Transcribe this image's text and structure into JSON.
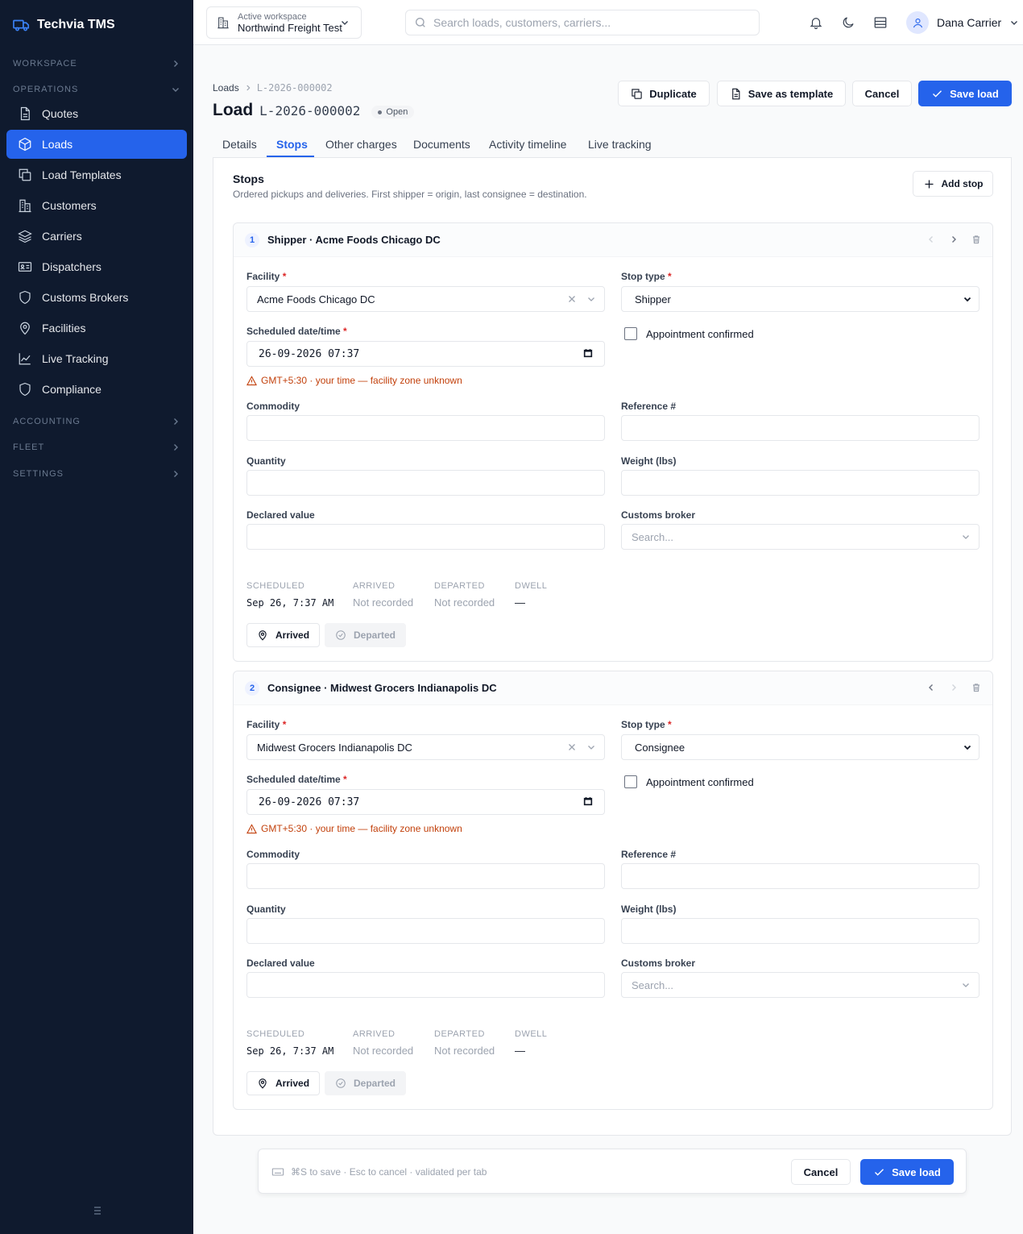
{
  "app": {
    "name": "Techvia TMS"
  },
  "sidebar": {
    "sections": {
      "workspace": "WORKSPACE",
      "operations": "OPERATIONS",
      "accounting": "ACCOUNTING",
      "fleet": "FLEET",
      "settings": "SETTINGS"
    },
    "items": [
      {
        "label": "Quotes",
        "icon": "document-icon"
      },
      {
        "label": "Loads",
        "icon": "box-icon",
        "active": true
      },
      {
        "label": "Load Templates",
        "icon": "copy-icon"
      },
      {
        "label": "Customers",
        "icon": "building-icon"
      },
      {
        "label": "Carriers",
        "icon": "layers-icon"
      },
      {
        "label": "Dispatchers",
        "icon": "id-card-icon"
      },
      {
        "label": "Customs Brokers",
        "icon": "shield-icon"
      },
      {
        "label": "Facilities",
        "icon": "map-pin-icon"
      },
      {
        "label": "Live Tracking",
        "icon": "chart-line-icon"
      },
      {
        "label": "Compliance",
        "icon": "shield-icon"
      }
    ]
  },
  "topbar": {
    "workspace_label": "Active workspace",
    "workspace_name": "Northwind Freight Test",
    "search_placeholder": "Search loads, customers, carriers...",
    "user_name": "Dana Carrier"
  },
  "header": {
    "breadcrumb_root": "Loads",
    "breadcrumb_current": "L-2026-000002",
    "title": "Load",
    "load_id": "L-2026-000002",
    "status": "Open",
    "buttons": {
      "duplicate": "Duplicate",
      "save_template": "Save as template",
      "cancel": "Cancel",
      "save": "Save load"
    }
  },
  "tabs": [
    "Details",
    "Stops",
    "Other charges",
    "Documents",
    "Activity timeline",
    "Live tracking"
  ],
  "active_tab": "Stops",
  "stops_panel": {
    "title": "Stops",
    "subtitle": "Ordered pickups and deliveries. First shipper = origin, last consignee = destination.",
    "add_stop": "Add stop"
  },
  "labels": {
    "facility": "Facility",
    "stop_type": "Stop type",
    "scheduled": "Scheduled date/time",
    "appointment": "Appointment confirmed",
    "commodity": "Commodity",
    "reference": "Reference #",
    "quantity": "Quantity",
    "weight": "Weight (lbs)",
    "declared_value": "Declared value",
    "customs_broker": "Customs broker",
    "customs_placeholder": "Search...",
    "stat_scheduled": "SCHEDULED",
    "stat_arrived": "ARRIVED",
    "stat_departed": "DEPARTED",
    "stat_dwell": "DWELL",
    "arrived_btn": "Arrived",
    "departed_btn": "Departed",
    "required_mark": "*"
  },
  "stops": [
    {
      "number": "1",
      "title": "Shipper · Acme Foods Chicago DC",
      "facility": "Acme Foods Chicago DC",
      "stop_type": "Shipper",
      "scheduled": "26-09-2026 07:37",
      "tz_warning": "GMT+5:30 · your time — facility zone unknown",
      "appointment_confirmed": false,
      "commodity": "",
      "reference": "",
      "quantity": "",
      "weight": "",
      "declared_value": "",
      "stat_scheduled": "Sep 26, 7:37 AM",
      "stat_arrived": "Not recorded",
      "stat_departed": "Not recorded",
      "stat_dwell": "—"
    },
    {
      "number": "2",
      "title": "Consignee · Midwest Grocers Indianapolis DC",
      "facility": "Midwest Grocers Indianapolis DC",
      "stop_type": "Consignee",
      "scheduled": "26-09-2026 07:37",
      "tz_warning": "GMT+5:30 · your time — facility zone unknown",
      "appointment_confirmed": false,
      "commodity": "",
      "reference": "",
      "quantity": "",
      "weight": "",
      "declared_value": "",
      "stat_scheduled": "Sep 26, 7:37 AM",
      "stat_arrived": "Not recorded",
      "stat_departed": "Not recorded",
      "stat_dwell": "—"
    }
  ],
  "footer": {
    "hint": "⌘S to save · Esc to cancel · validated per tab",
    "cancel": "Cancel",
    "save": "Save load"
  },
  "colors": {
    "accent": "#2563eb",
    "sidebar_bg": "#0f1a2e",
    "warning": "#c2410c"
  }
}
